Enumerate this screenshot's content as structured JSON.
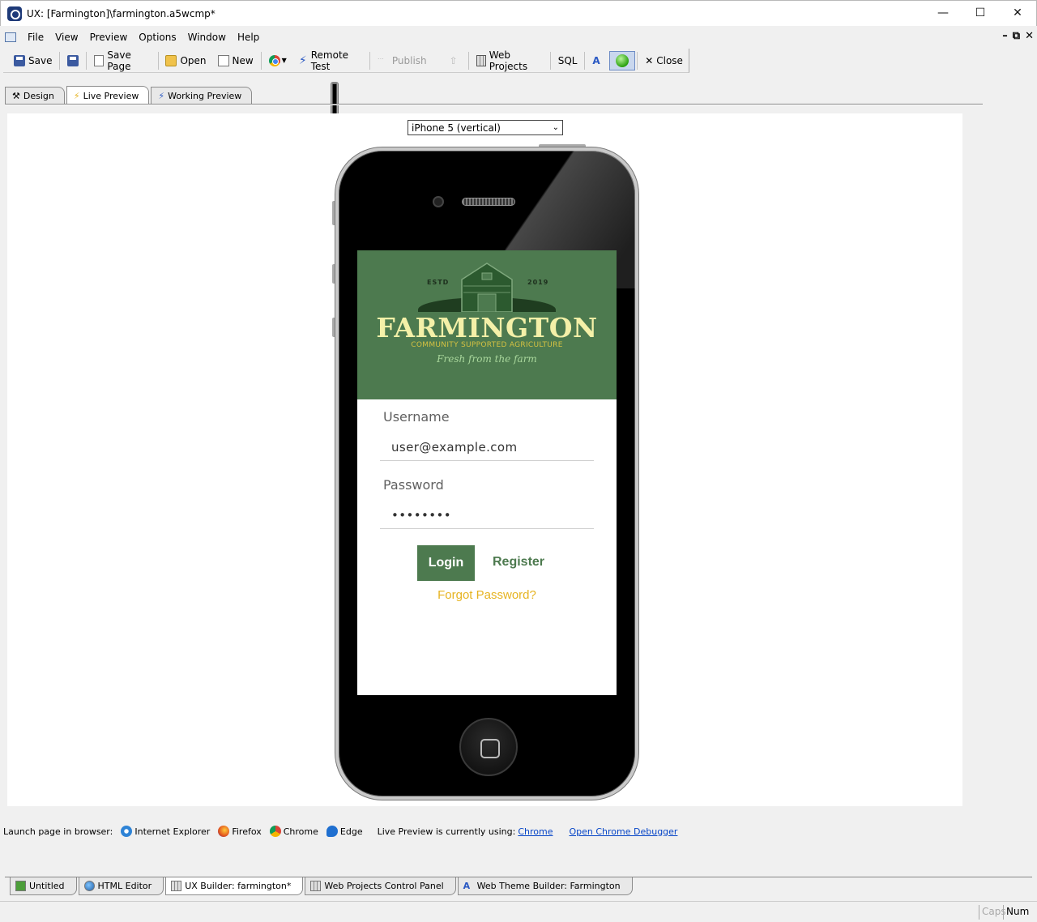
{
  "window": {
    "title": "UX: [Farmington]\\farmington.a5wcmp*",
    "controls": [
      "minimize",
      "maximize",
      "close"
    ]
  },
  "menu": {
    "items": [
      "File",
      "View",
      "Preview",
      "Options",
      "Window",
      "Help"
    ]
  },
  "toolbar": {
    "save": "Save",
    "save_page": "Save Page",
    "open": "Open",
    "new": "New",
    "remote_test": "Remote Test",
    "publish": "Publish",
    "web_projects": "Web Projects",
    "sql": "SQL",
    "close": "Close"
  },
  "view_tabs": [
    "Design",
    "Live Preview",
    "Working Preview"
  ],
  "preview": {
    "device": "iPhone 5 (vertical)",
    "app": {
      "estd": "ESTD",
      "year": "2019",
      "brand": "FARMINGTON",
      "brand_sub": "COMMUNITY SUPPORTED AGRICULTURE",
      "tagline": "Fresh from the farm",
      "username_label": "Username",
      "username_value": "user@example.com",
      "password_label": "Password",
      "password_value": "••••••••",
      "login_button": "Login",
      "register_link": "Register",
      "forgot_link": "Forgot Password?",
      "colors": {
        "brand_green": "#4d7a4f",
        "accent_gold": "#e6b320",
        "logo_cream": "#f4f0a8"
      }
    }
  },
  "launch": {
    "label": "Launch page in browser:",
    "browsers": [
      "Internet Explorer",
      "Firefox",
      "Chrome",
      "Edge"
    ],
    "live_preview_text": "Live Preview is currently using:",
    "live_preview_browser": "Chrome",
    "debugger_link": "Open Chrome Debugger"
  },
  "doc_tabs": [
    "Untitled",
    "HTML Editor",
    "UX Builder: farmington*",
    "Web Projects Control Panel",
    "Web Theme Builder: Farmington"
  ],
  "status": {
    "caps": "Caps",
    "num": "Num"
  }
}
